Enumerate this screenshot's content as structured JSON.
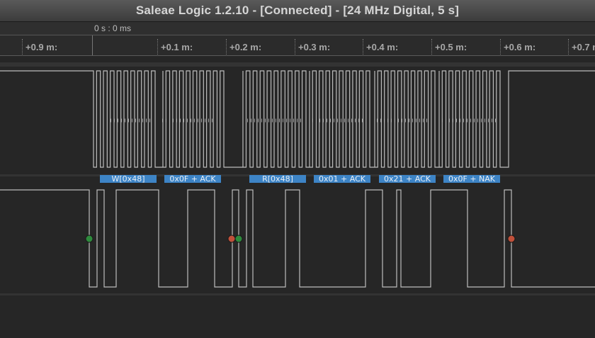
{
  "window": {
    "title": "Saleae Logic 1.2.10 - [Connected] - [24 MHz Digital, 5 s]"
  },
  "timeline": {
    "origin_label": "0 s : 0 ms",
    "ticks": [
      "+0.9 m:",
      "+0.1 m:",
      "+0.2 m:",
      "+0.3 m:",
      "+0.4 m:",
      "+0.5 m:",
      "+0.6 m:",
      "+0.7 m"
    ]
  },
  "decoder": {
    "frames": [
      {
        "label": "W[0x48]"
      },
      {
        "label": "0x0F + ACK"
      },
      {
        "label": "R[0x48]"
      },
      {
        "label": "0x01 + ACK"
      },
      {
        "label": "0x21 + ACK"
      },
      {
        "label": "0x0F + NAK"
      }
    ],
    "frame_color": "#3d84c6"
  },
  "markers": [
    {
      "type": "start",
      "color": "#2e8b3d"
    },
    {
      "type": "stop",
      "color": "#c0503a"
    },
    {
      "type": "start",
      "color": "#2e8b3d"
    },
    {
      "type": "stop",
      "color": "#c0503a"
    }
  ],
  "colors": {
    "trace": "#bdbdbd",
    "background": "#262626"
  }
}
